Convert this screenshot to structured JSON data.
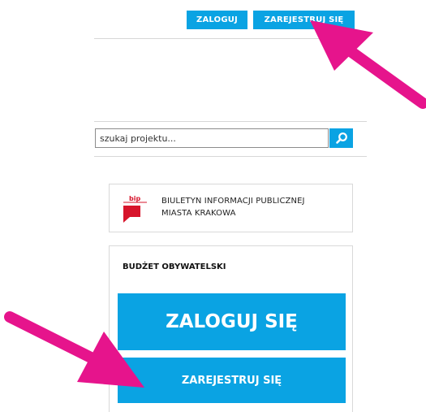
{
  "header": {
    "login_label": "ZALOGUJ",
    "register_label": "ZAREJESTRUJ SIĘ"
  },
  "search": {
    "placeholder": "szukaj projektu..."
  },
  "bip": {
    "logo_text": "bip",
    "line1": "BIULETYN INFORMACJI PUBLICZNEJ",
    "line2": "MIASTA KRAKOWA"
  },
  "budget": {
    "title": "BUDŻET OBYWATELSKI",
    "login_label": "ZALOGUJ SIĘ",
    "register_label": "ZAREJESTRUJ SIĘ"
  },
  "colors": {
    "accent": "#0aa3e3",
    "annotation": "#e6148c"
  }
}
